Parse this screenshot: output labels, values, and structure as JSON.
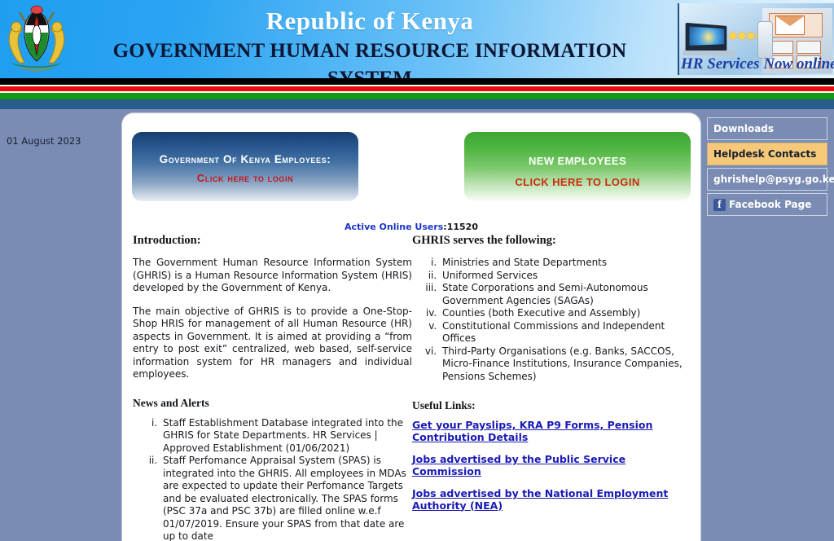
{
  "header": {
    "line1": "Republic of Kenya",
    "line2": "GOVERNMENT HUMAN RESOURCE INFORMATION SYSTEM",
    "crest_icon": "kenya-coat-of-arms-icon",
    "promo_caption": "HR Services Now online"
  },
  "date_stamp": "01 August 2023",
  "buttons": {
    "gok_line1": "Government Of Kenya Employees:",
    "gok_line2": "Click here to login",
    "new_line1": "NEW EMPLOYEES",
    "new_line2": "CLICK HERE TO LOGIN"
  },
  "active_users": {
    "label": "Active Online Users",
    "separator": ":",
    "count": "11520"
  },
  "introduction": {
    "heading": "Introduction:",
    "paragraphs": [
      "The Government Human Resource Information System (GHRIS) is a Human Resource Information System (HRIS) developed by the Government of Kenya.",
      "The main objective of GHRIS is to provide a One-Stop-Shop HRIS for management of all Human Resource (HR) aspects in Government. It is aimed at providing a “from entry to post exit” centralized, web based, self-service information system for HR managers and individual employees."
    ]
  },
  "serves": {
    "heading": "GHRIS serves the following:",
    "items": [
      "Ministries and State Departments",
      "Uniformed Services",
      "State Corporations and Semi-Autonomous Government Agencies (SAGAs)",
      "Counties (both Executive and Assembly)",
      "Constitutional Commissions and Independent Offices",
      "Third-Party Organisations (e.g. Banks, SACCOS, Micro-Finance Institutions, Insurance Companies, Pensions Schemes)"
    ]
  },
  "news": {
    "heading": "News and Alerts",
    "items": [
      "Staff Establishment Database integrated into the GHRIS for State Departments. HR Services | Approved Establishment (01/06/2021)",
      "Staff Perfomance Appraisal System (SPAS) is integrated into the GHRIS. All employees in MDAs are expected to update their Perfomance Targets and be evaluated electronically. The SPAS forms (PSC 37a and PSC 37b) are filled online w.e.f 01/07/2019. Ensure your SPAS from that date are up to date"
    ]
  },
  "useful_links": {
    "heading": "Useful Links:",
    "links": [
      "Get your Payslips, KRA P9 Forms, Pension Contribution Details",
      "Jobs advertised by the Public Service Commission",
      "Jobs advertised by the National Employment Authority (NEA)"
    ]
  },
  "sidebar": {
    "items": [
      {
        "label": "Downloads",
        "highlight": false,
        "icon": null
      },
      {
        "label": "Helpdesk Contacts",
        "highlight": true,
        "icon": null
      },
      {
        "label": "ghrishelp@psyg.go.ke",
        "highlight": false,
        "icon": null
      },
      {
        "label": "Facebook Page",
        "highlight": false,
        "icon": "facebook-icon",
        "icon_glyph": "f"
      }
    ]
  },
  "colors": {
    "page_background": "#7a8cb3",
    "banner_blue": "#2ba4f2",
    "flag_red": "#e80c0c",
    "flag_green": "#139b13",
    "bluebar": "#2a5b8d",
    "link_blue": "#1a1ab5",
    "highlight_tan": "#f6c97a",
    "login_red": "#c41616"
  }
}
